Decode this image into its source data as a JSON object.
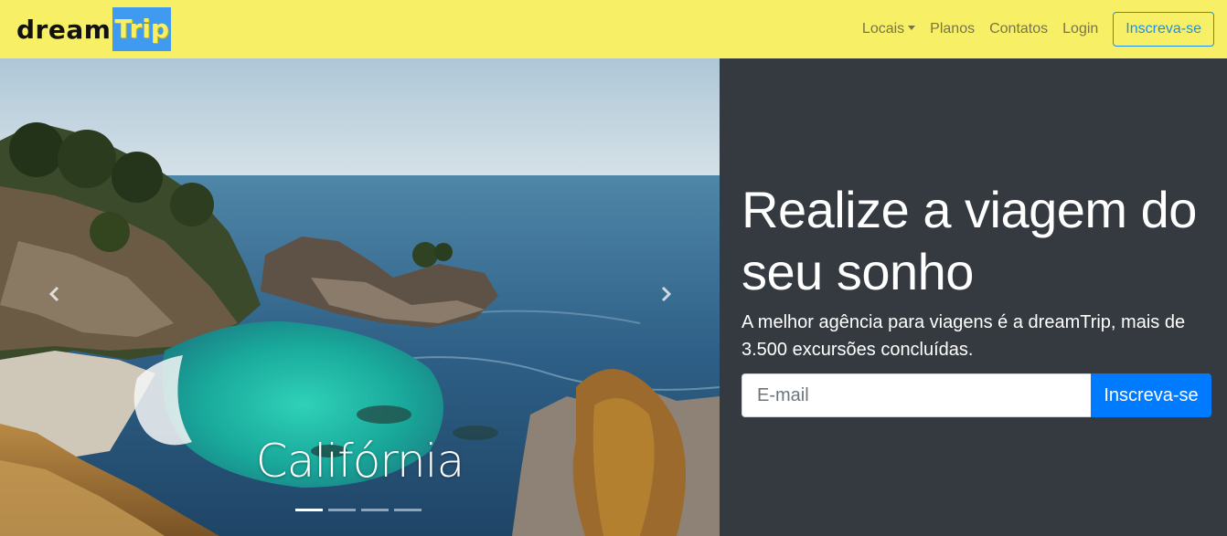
{
  "navbar": {
    "brand_part1": "dream",
    "brand_part2": "Trip",
    "links": [
      "Locais",
      "Planos",
      "Contatos",
      "Login"
    ],
    "signup_label": "Inscreva-se"
  },
  "carousel": {
    "caption": "Califórnia",
    "slide_count": 4,
    "active_index": 0
  },
  "hero": {
    "title": "Realize a viagem do seu sonho",
    "subtitle": "A melhor agência para viagens é a dreamTrip, mais de 3.500 excursões concluídas.",
    "email_placeholder": "E-mail",
    "cta_label": "Inscreva-se"
  },
  "colors": {
    "navbar_bg": "#f7f067",
    "hero_bg": "#343a40",
    "primary": "#007bff",
    "outline_button": "#1f8fe6"
  }
}
